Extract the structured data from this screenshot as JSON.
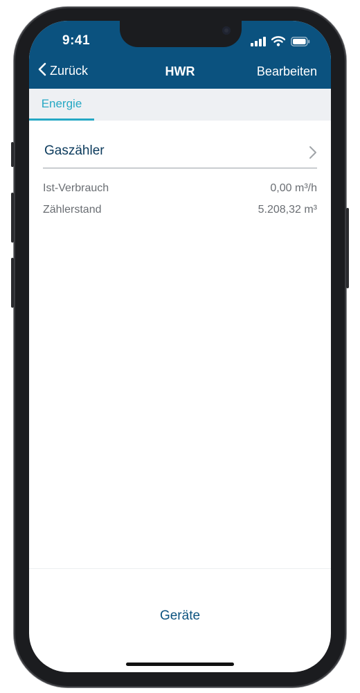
{
  "status_bar": {
    "time": "9:41",
    "icons": [
      "cellular-signal-icon",
      "wifi-icon",
      "battery-icon"
    ]
  },
  "nav": {
    "back_label": "Zurück",
    "title": "HWR",
    "edit_label": "Bearbeiten"
  },
  "tabs": [
    {
      "label": "Energie",
      "active": true
    }
  ],
  "section": {
    "title": "Gaszähler"
  },
  "rows": [
    {
      "label": "Ist-Verbrauch",
      "value": "0,00 m³/h"
    },
    {
      "label": "Zählerstand",
      "value": "5.208,32 m³"
    }
  ],
  "bottom": {
    "button_label": "Geräte"
  },
  "colors": {
    "header": "#0b527f",
    "accent": "#25a8c4",
    "tab_background": "#eef0f3"
  }
}
